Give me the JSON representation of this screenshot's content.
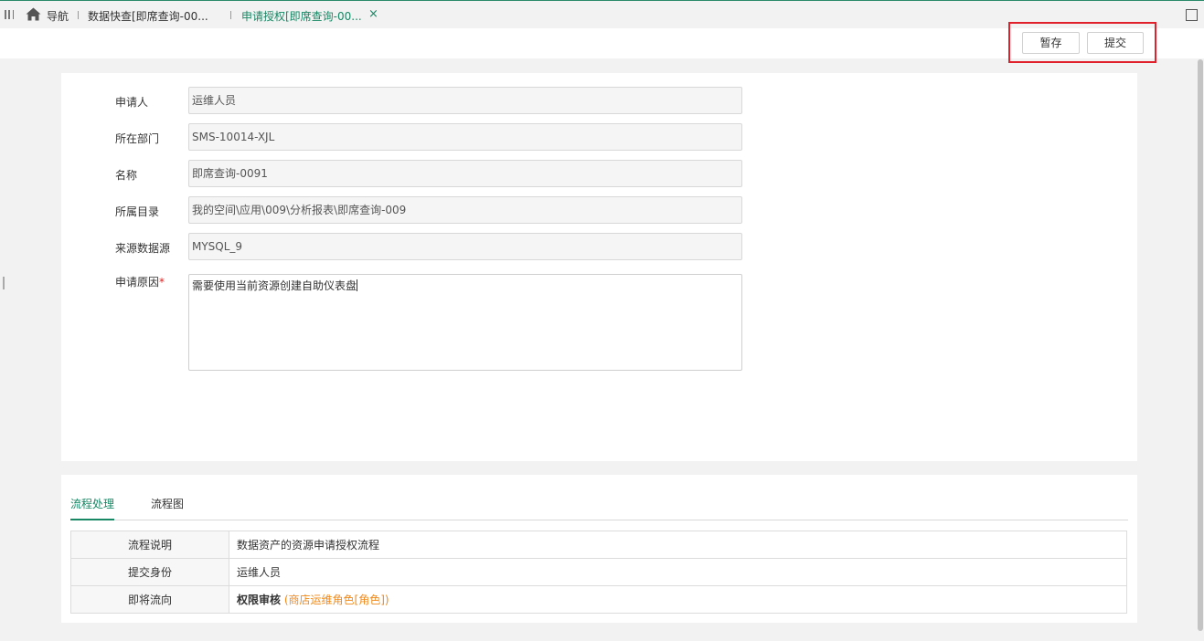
{
  "tabs": {
    "nav_label": "导航",
    "tab1_label": "数据快查[即席查询-00...",
    "tab2_label": "申请授权[即席查询-00...",
    "close_glyph": "×"
  },
  "toolbar": {
    "save_label": "暂存",
    "submit_label": "提交"
  },
  "form": {
    "applicant_label": "申请人",
    "applicant_value": "运维人员",
    "department_label": "所在部门",
    "department_value": "SMS-10014-XJL",
    "name_label": "名称",
    "name_value": "即席查询-0091",
    "directory_label": "所属目录",
    "directory_value": "我的空间\\应用\\009\\分析报表\\即席查询-009",
    "datasource_label": "来源数据源",
    "datasource_value": "MYSQL_9",
    "reason_label": "申请原因",
    "reason_required": "*",
    "reason_value": "需要使用当前资源创建自助仪表盘"
  },
  "process": {
    "tabs": [
      "流程处理",
      "流程图"
    ],
    "rows": [
      {
        "key": "流程说明",
        "value": "数据资产的资源申请授权流程"
      },
      {
        "key": "提交身份",
        "value": "运维人员"
      },
      {
        "key": "即将流向",
        "value": "权限审核",
        "extra": "(商店运维角色[角色])"
      }
    ]
  },
  "colors": {
    "accent": "#178764",
    "highlight_border": "#e0202a",
    "orange": "#f08a1c"
  },
  "icons": [
    "menu-icon",
    "home-icon",
    "close-icon",
    "maximize-icon"
  ]
}
